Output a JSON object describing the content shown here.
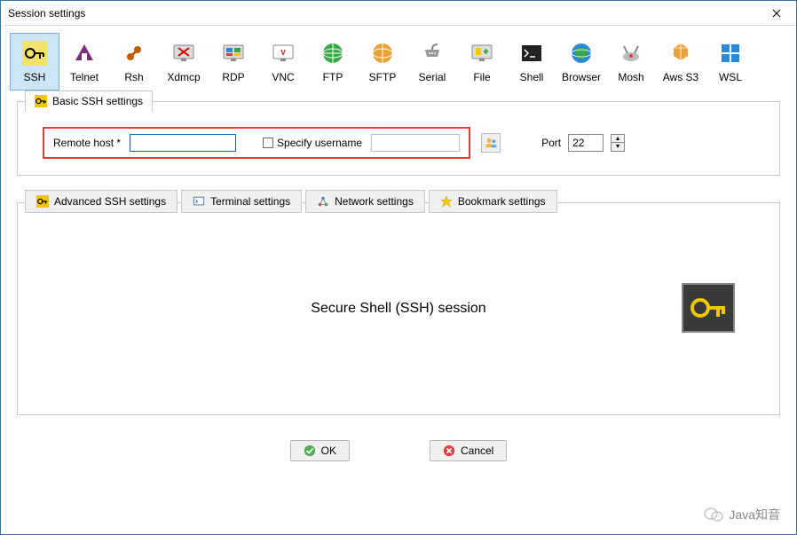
{
  "window": {
    "title": "Session settings"
  },
  "protocols": [
    {
      "id": "ssh",
      "label": "SSH",
      "selected": true
    },
    {
      "id": "telnet",
      "label": "Telnet",
      "selected": false
    },
    {
      "id": "rsh",
      "label": "Rsh",
      "selected": false
    },
    {
      "id": "xdmcp",
      "label": "Xdmcp",
      "selected": false
    },
    {
      "id": "rdp",
      "label": "RDP",
      "selected": false
    },
    {
      "id": "vnc",
      "label": "VNC",
      "selected": false
    },
    {
      "id": "ftp",
      "label": "FTP",
      "selected": false
    },
    {
      "id": "sftp",
      "label": "SFTP",
      "selected": false
    },
    {
      "id": "serial",
      "label": "Serial",
      "selected": false
    },
    {
      "id": "file",
      "label": "File",
      "selected": false
    },
    {
      "id": "shell",
      "label": "Shell",
      "selected": false
    },
    {
      "id": "browser",
      "label": "Browser",
      "selected": false
    },
    {
      "id": "mosh",
      "label": "Mosh",
      "selected": false
    },
    {
      "id": "aws",
      "label": "Aws S3",
      "selected": false
    },
    {
      "id": "wsl",
      "label": "WSL",
      "selected": false
    }
  ],
  "basic": {
    "tab_label": "Basic SSH settings",
    "remote_host_label": "Remote host *",
    "remote_host_value": "",
    "specify_username_label": "Specify username",
    "specify_username_checked": false,
    "username_value": "",
    "port_label": "Port",
    "port_value": "22"
  },
  "adv_tabs": {
    "advanced": "Advanced SSH settings",
    "terminal": "Terminal settings",
    "network": "Network settings",
    "bookmark": "Bookmark settings"
  },
  "session_description": "Secure Shell (SSH) session",
  "buttons": {
    "ok": "OK",
    "cancel": "Cancel"
  },
  "watermark": "Java知音"
}
